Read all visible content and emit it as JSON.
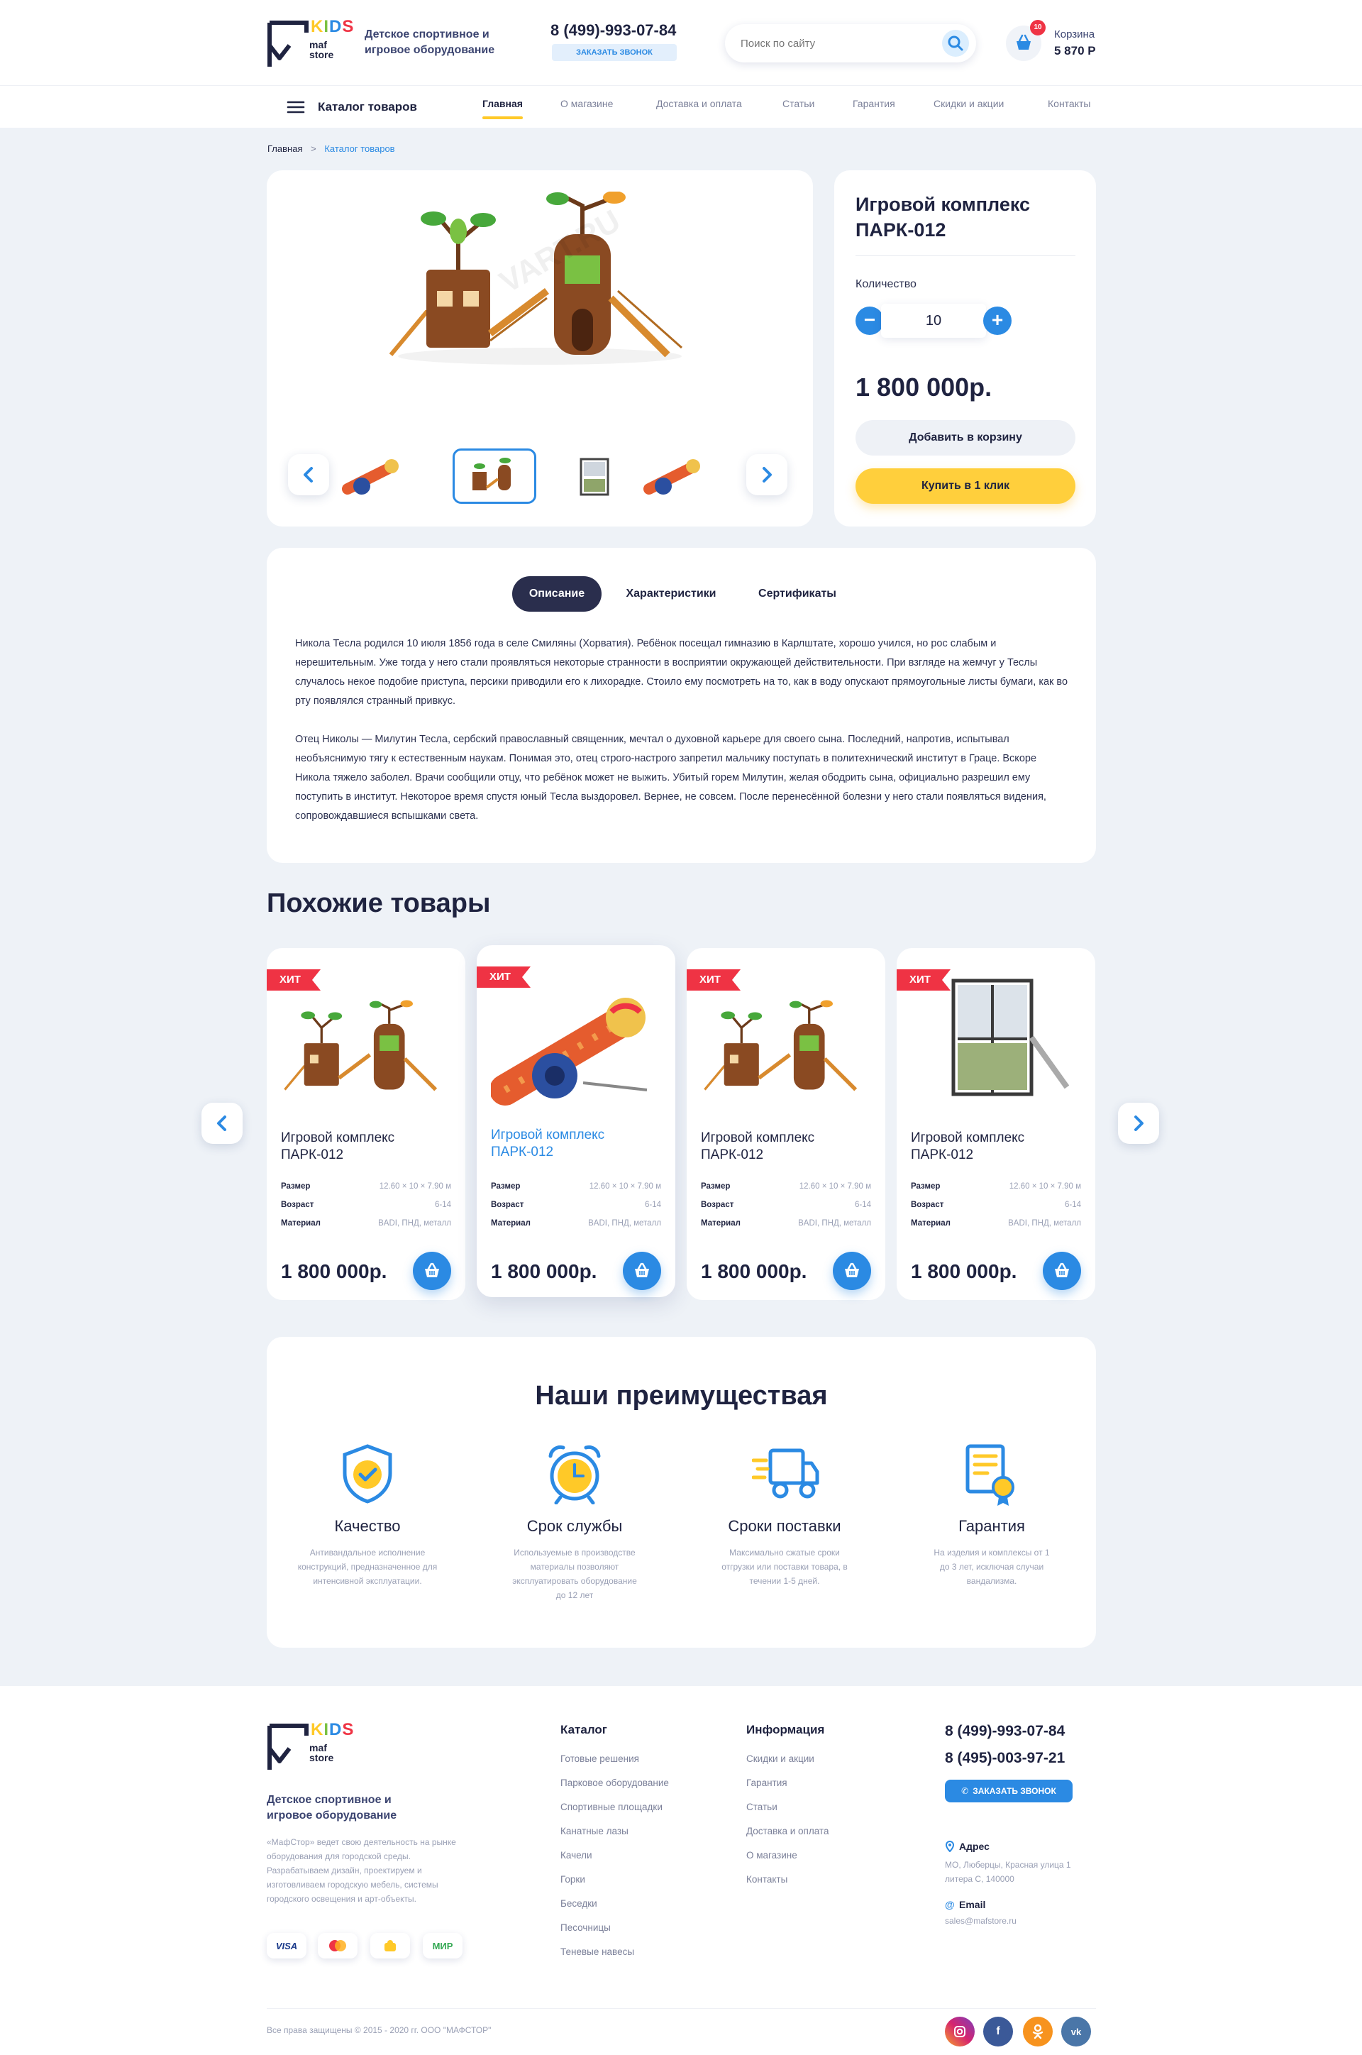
{
  "header": {
    "logo_kids": "KIDS",
    "logo_maf": "maf",
    "logo_store": "store",
    "tagline": "Детское спортивное и игровое оборудование",
    "phone": "8 (499)-993-07-84",
    "call_btn": "заказать звонок",
    "search_placeholder": "Поиск по сайту",
    "cart_count": "10",
    "cart_label": "Корзина",
    "cart_total": "5 870 Р"
  },
  "nav": {
    "catalog": "Каталог товаров",
    "items": [
      "Главная",
      "О магазине",
      "Доставка и оплата",
      "Статьи",
      "Гарантия",
      "Скидки и акции",
      "Контакты"
    ]
  },
  "breadcrumb": {
    "home": "Главная",
    "sep": ">",
    "current": "Каталог товаров"
  },
  "product": {
    "title": "Игровой комплекс ПАРК-012",
    "qty_label": "Количество",
    "qty": "10",
    "price": "1 800 000р.",
    "add_to_cart": "Добавить в корзину",
    "buy_one_click": "Купить в 1 клик",
    "watermark": "VART.RU"
  },
  "tabs": [
    "Описание",
    "Характеристики",
    "Сертификаты"
  ],
  "description": [
    "Никола Тесла родился 10 июля 1856 года в селе Смиляны (Хорватия). Ребёнок посещал гимназию в Карлштате, хорошо учился, но рос слабым и нерешительным. Уже тогда у него стали проявляться некоторые странности в восприятии окружающей действительности. При взгляде на жемчуг у Теслы случалось некое подобие приступа, персики приводили его к лихорадке. Стоило ему посмотреть на то, как в воду опускают прямоугольные листы бумаги, как во рту появлялся странный привкус.",
    "Отец Николы — Милутин Тесла, сербский православный священник, мечтал о духовной карьере для своего сына. Последний, напротив, испытывал необъяснимую тягу к естественным наукам. Понимая это, отец строго-настрого запретил мальчику поступать в политехнический институт в Граце. Вскоре Никола тяжело заболел. Врачи сообщили отцу, что ребёнок может не выжить. Убитый горем Милутин, желая ободрить сына, официально разрешил ему поступить в институт. Некоторое время спустя юный Тесла выздоровел. Вернее, не совсем. После перенесённой болезни у него стали появляться видения, сопровождавшиеся вспышками света."
  ],
  "similar": {
    "title": "Похожие товары",
    "hit": "ХИТ",
    "spec_labels": [
      "Размер",
      "Возраст",
      "Материал"
    ],
    "items": [
      {
        "name": "Игровой комплекс ПАРК-012",
        "size": "12.60 × 10 × 7.90 м",
        "age": "6-14",
        "material": "BADI, ПНД, металл",
        "price": "1 800 000р.",
        "img": "playhouse"
      },
      {
        "name": "Игровой комплекс ПАРК-012",
        "size": "12.60 × 10 × 7.90 м",
        "age": "6-14",
        "material": "BADI, ПНД, металл",
        "price": "1 800 000р.",
        "img": "tube"
      },
      {
        "name": "Игровой комплекс ПАРК-012",
        "size": "12.60 × 10 × 7.90 м",
        "age": "6-14",
        "material": "BADI, ПНД, металл",
        "price": "1 800 000р.",
        "img": "playhouse"
      },
      {
        "name": "Игровой комплекс ПАРК-012",
        "size": "12.60 × 10 × 7.90 м",
        "age": "6-14",
        "material": "BADI, ПНД, металл",
        "price": "1 800 000р.",
        "img": "tower"
      }
    ]
  },
  "advantages": {
    "title": "Наши преимуществая",
    "items": [
      {
        "title": "Качество",
        "text": "Антивандальное исполнение конструкций, предназначенное для интенсивной эксплуатации.",
        "icon": "shield-icon"
      },
      {
        "title": "Срок службы",
        "text": "Используемые в производстве материалы позволяют эксплуатировать оборудование до 12 лет",
        "icon": "alarm-clock-icon"
      },
      {
        "title": "Сроки поставки",
        "text": "Максимально сжатые сроки отгрузки или поставки товара, в течении 1-5 дней.",
        "icon": "truck-icon"
      },
      {
        "title": "Гарантия",
        "text": "На изделия и комплексы от 1 до 3 лет, исключая случаи вандализма.",
        "icon": "certificate-icon"
      }
    ]
  },
  "footer": {
    "tagline": "Детское спортивное и игровое оборудование",
    "about": "«МафСтор» ведет свою деятельность на рынке оборудования для городской среды. Разрабатываем дизайн, проектируем и изготовливаем городскую мебель, системы городского освещения и арт-объекты.",
    "payments": [
      "VISA",
      "MC",
      "Я",
      "МИР"
    ],
    "catalog_title": "Каталог",
    "catalog_links": [
      "Готовые решения",
      "Парковое оборудование",
      "Спортивные площадки",
      "Канатные лазы",
      "Качели",
      "Горки",
      "Беседки",
      "Песочницы",
      "Теневые навесы"
    ],
    "info_title": "Информация",
    "info_links": [
      "Скидки и акции",
      "Гарантия",
      "Статьи",
      "Доставка и оплата",
      "О магазине",
      "Контакты"
    ],
    "phone1": "8 (499)-993-07-84",
    "phone2": "8 (495)-003-97-21",
    "call_btn": "заказать звонок",
    "address_label": "Адрес",
    "address": "МО, Люберцы, Красная улица 1 литера С, 140000",
    "email_label": "Email",
    "email": "sales@mafstore.ru",
    "copyright": "Все права защищены © 2015 - 2020 гг. ООО \"МАФСТОР\"",
    "socials": [
      "instagram",
      "facebook",
      "odnoklassniki",
      "vk"
    ]
  },
  "colors": {
    "accent": "#2b8ae3",
    "dark": "#1f2340",
    "yellow": "#ffc928",
    "red": "#ef3344",
    "bg": "#eef2f7"
  }
}
